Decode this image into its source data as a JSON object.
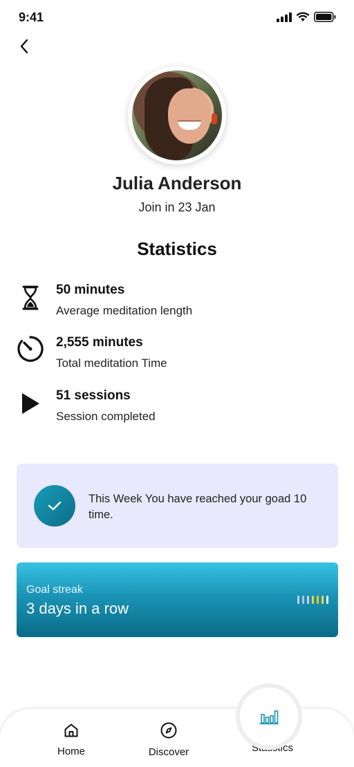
{
  "status_bar": {
    "time": "9:41"
  },
  "profile": {
    "name": "Julia Anderson",
    "joined": "Join in 23 Jan"
  },
  "statistics": {
    "title": "Statistics",
    "items": [
      {
        "icon": "hourglass-icon",
        "value": "50 minutes",
        "label": "Average meditation length"
      },
      {
        "icon": "timer-icon",
        "value": "2,555 minutes",
        "label": "Total meditation Time"
      },
      {
        "icon": "play-icon",
        "value": "51 sessions",
        "label": "Session completed"
      }
    ]
  },
  "goal_card": {
    "text": "This Week You have reached your goad 10 time."
  },
  "streak_card": {
    "label": "Goal streak",
    "value": "3 days in a row",
    "bar_colors": [
      "#bcd3f5",
      "#a6c6f3",
      "#c7d7ef",
      "#f4d03f",
      "#f4c430",
      "#f6d84a",
      "#eef3fb"
    ]
  },
  "tab_bar": {
    "tabs": [
      {
        "id": "home",
        "label": "Home",
        "icon": "home-icon"
      },
      {
        "id": "discover",
        "label": "Discover",
        "icon": "compass-icon"
      },
      {
        "id": "statistics",
        "label": "Statistics",
        "icon": "bar-chart-icon"
      }
    ],
    "active": "statistics"
  },
  "colors": {
    "accent": "#1a93b5",
    "goal_card_bg": "#e8e9fc"
  }
}
